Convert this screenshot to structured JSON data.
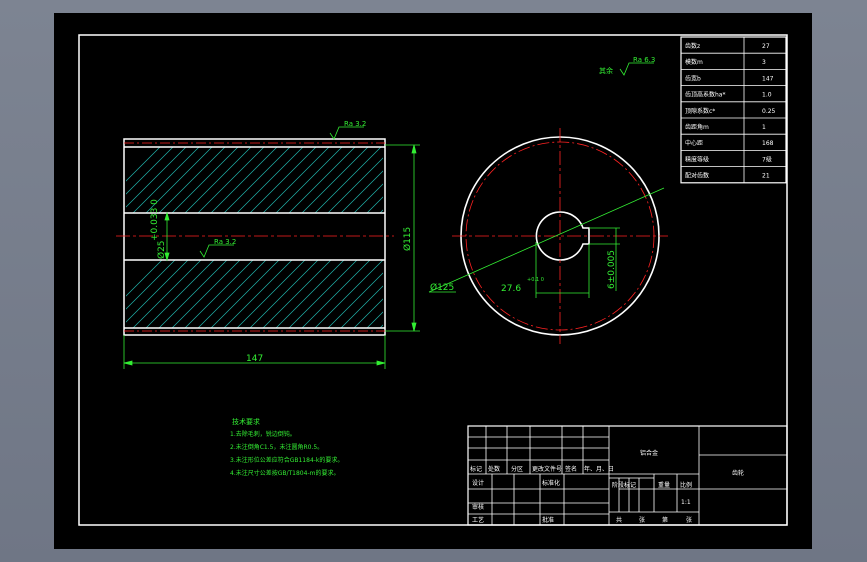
{
  "colors": {
    "background": "#000000",
    "outline": "#ffffff",
    "dimension": "#33ee33",
    "centerline": "#ff2222",
    "hatch": "#20b2aa",
    "app_frame": "#7d8492"
  },
  "gear_params": {
    "rows": [
      {
        "label": "齿数z",
        "value": "27"
      },
      {
        "label": "模数m",
        "value": "3"
      },
      {
        "label": "齿宽b",
        "value": "147"
      },
      {
        "label": "齿顶高系数ha*",
        "value": "1.0"
      },
      {
        "label": "顶隙系数c*",
        "value": "0.25"
      },
      {
        "label": "齿距角m",
        "value": "1"
      },
      {
        "label": "中心距",
        "value": "168"
      },
      {
        "label": "精度等级",
        "value": "7级"
      },
      {
        "label": "配对齿数",
        "value": "21"
      }
    ]
  },
  "annotations": {
    "surface_other": "其余",
    "ra_top": "Ra 6.3",
    "ra_side": "Ra 3.2",
    "ra_bore": "Ra 3.2"
  },
  "dimensions": {
    "length": "147",
    "height": "Ø115",
    "bore": "Ø25",
    "bore_tol": "+0.033\n0",
    "outer_dia": "Ø125",
    "keyway_depth": "27.6",
    "keyway_depth_tol": "+0.1\n0",
    "keyway_width": "6±0.005"
  },
  "tech_req": {
    "title": "技术要求",
    "lines": [
      "1.去除毛刺，锐边倒钝。",
      "2.未注倒角C1.5，未注圆角R0.5。",
      "3.未注形位公差应符合GB1184-k的要求。",
      "4.未注尺寸公差按GB/T1804-m的要求。"
    ]
  },
  "title_block": {
    "material": "铝合金",
    "part_name": "齿轮",
    "scale": "1:1",
    "header_labels": [
      "标记",
      "处数",
      "分区",
      "更改文件号",
      "签名",
      "年、月、日"
    ],
    "row_labels": [
      "设计",
      "标准化",
      "审核",
      "工艺",
      "批准"
    ],
    "stage_label": "阶段标记",
    "weight_label": "重量",
    "scale_label": "比例",
    "sheet_labels": [
      "共",
      "张",
      "第",
      "张"
    ]
  }
}
